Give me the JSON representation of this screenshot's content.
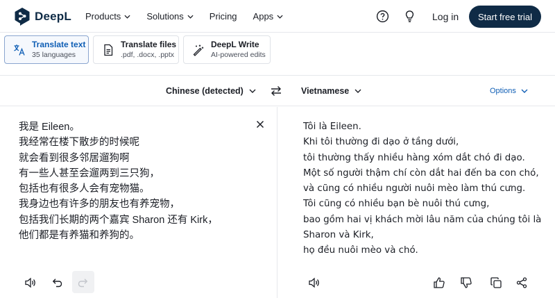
{
  "nav": {
    "brand": "DeepL",
    "menu": [
      "Products",
      "Solutions",
      "Pricing",
      "Apps"
    ],
    "login": "Log in",
    "cta": "Start free trial"
  },
  "tabs": [
    {
      "title": "Translate text",
      "subtitle": "35 languages",
      "icon": "translate-icon",
      "active": true
    },
    {
      "title": "Translate files",
      "subtitle": ".pdf, .docx, .pptx",
      "icon": "file-icon",
      "active": false
    },
    {
      "title": "DeepL Write",
      "subtitle": "AI-powered edits",
      "icon": "magic-pen-icon",
      "active": false
    }
  ],
  "langbar": {
    "source": "Chinese (detected)",
    "target": "Vietnamese",
    "options": "Options"
  },
  "source_text": [
    "我是 Eileen。",
    "我经常在楼下散步的时候呢",
    "就会看到很多邻居遛狗啊",
    "有一些人甚至会遛两到三只狗，",
    "包括也有很多人会有宠物猫。",
    "我身边也有许多的朋友也有养宠物，",
    "包括我们长期的两个嘉宾 Sharon 还有 Kirk，",
    "他们都是有养猫和养狗的。"
  ],
  "target_text": [
    "Tôi là Eileen.",
    "Khi tôi thường đi dạo ở tầng dưới,",
    "tôi thường thấy nhiều hàng xóm dắt chó đi dạo.",
    "Một số người thậm chí còn dắt hai đến ba con chó,",
    "và cũng có nhiều người nuôi mèo làm thú cưng.",
    "Tôi cũng có nhiều bạn bè nuôi thú cưng,",
    "bao gồm hai vị khách mời lâu năm của chúng tôi là",
    "Sharon và Kirk,",
    "họ đều nuôi mèo và chó."
  ],
  "colors": {
    "brand_navy": "#0f2b46",
    "accent_blue": "#0f5eb5",
    "border": "#e6e8ec"
  }
}
